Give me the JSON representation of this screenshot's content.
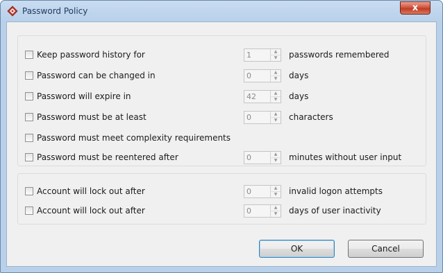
{
  "window": {
    "title": "Password Policy",
    "close_glyph": "x"
  },
  "policy_group": {
    "rows": [
      {
        "label": "Keep password history for",
        "value": "1",
        "suffix": "passwords remembered"
      },
      {
        "label": "Password can be changed in",
        "value": "0",
        "suffix": "days"
      },
      {
        "label": "Password will expire in",
        "value": "42",
        "suffix": "days"
      },
      {
        "label": "Password must be at least",
        "value": "0",
        "suffix": "characters"
      },
      {
        "label": "Password must meet complexity requirements"
      },
      {
        "label": "Password must be reentered after",
        "value": "0",
        "suffix": "minutes without user input"
      }
    ]
  },
  "lockout_group": {
    "rows": [
      {
        "label": "Account will lock out after",
        "value": "0",
        "suffix": "invalid logon attempts"
      },
      {
        "label": "Account will lock out after",
        "value": "0",
        "suffix": "days of user inactivity"
      }
    ]
  },
  "buttons": {
    "ok": "OK",
    "cancel": "Cancel"
  }
}
